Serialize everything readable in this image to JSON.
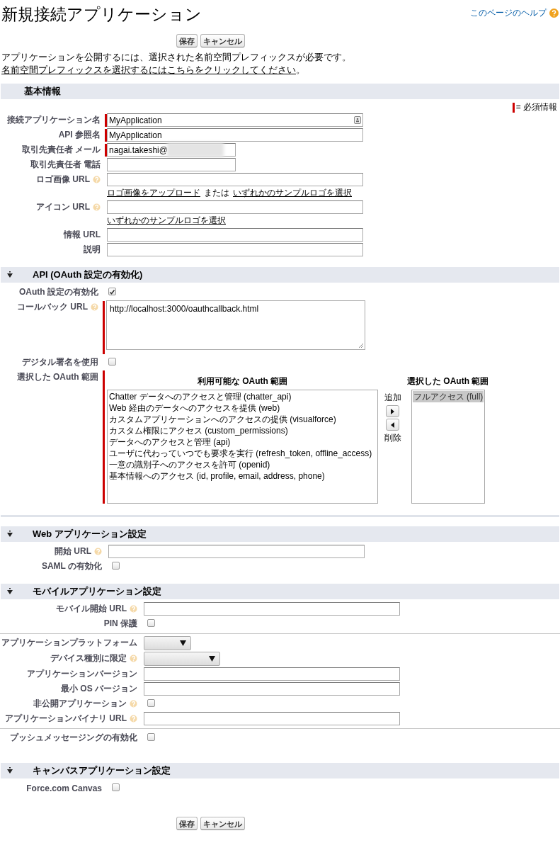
{
  "title": "新規接続アプリケーション",
  "help_link": {
    "text": "このページのヘルプ"
  },
  "top_buttons": [
    {
      "label": "保存"
    },
    {
      "label": "キャンセル"
    }
  ],
  "notice": {
    "text": "アプリケーションを公開するには、選択された名前空間プレフィックスが必要です。",
    "link": "名前空間プレフィックスを選択するにはこちらをクリックしてください",
    "end": "。"
  },
  "sections": [
    {
      "title": "基本情報",
      "collapsible": false,
      "rule_after": false,
      "legend": "= 必須情報",
      "rows": [
        {
          "kind": "input",
          "label": "接続アプリケーション名",
          "value": "MyApplication",
          "required": true,
          "lookup_icon": true
        },
        {
          "kind": "input",
          "label": "API 参照名",
          "value": "MyApplication",
          "required": true
        },
        {
          "kind": "short-input",
          "label": "取引先責任者 メール",
          "value": "nagai.takeshi@",
          "required": true,
          "redacted": true
        },
        {
          "kind": "short-input",
          "label": "取引先責任者 電話"
        },
        {
          "kind": "input",
          "label": "ロゴ画像 URL",
          "help": true,
          "links": [
            {
              "kind": "link",
              "text": "ロゴ画像をアップロード"
            },
            {
              "kind": "text",
              "text": "または"
            },
            {
              "kind": "link",
              "text": "いずれかのサンプルロゴを選択"
            }
          ]
        },
        {
          "kind": "input",
          "label": "アイコン URL",
          "help": true,
          "links": [
            {
              "kind": "link",
              "text": "いずれかのサンプルロゴを選択"
            }
          ]
        },
        {
          "kind": "input",
          "label": "情報 URL"
        },
        {
          "kind": "input",
          "label": "説明"
        }
      ]
    },
    {
      "title": "API (OAuth 設定の有効化)",
      "collapsible": true,
      "rule_after": true,
      "rows": [
        {
          "kind": "checkbox",
          "label": "OAuth 設定の有効化",
          "checked": true
        },
        {
          "kind": "textarea",
          "label": "コールバック URL",
          "help": true,
          "required": true,
          "value": "http://localhost:3000/oauthcallback.html"
        },
        {
          "kind": "checkbox",
          "label": "デジタル署名を使用",
          "checked": false
        },
        {
          "kind": "scopes",
          "label": "選択した OAuth 範囲",
          "required": true,
          "available_title": "利用可能な OAuth 範囲",
          "available": [
            {
              "text": "Chatter データへのアクセスと管理 (chatter_api)",
              "selected": false
            },
            {
              "text": "Web 経由のデータへのアクセスを提供 (web)",
              "selected": false
            },
            {
              "text": "カスタムアプリケーションへのアクセスの提供 (visualforce)",
              "selected": false
            },
            {
              "text": "カスタム権限にアクセス (custom_permissions)",
              "selected": false
            },
            {
              "text": "データへのアクセスと管理 (api)",
              "selected": false
            },
            {
              "text": "ユーザに代わっていつでも要求を実行 (refresh_token, offline_access)",
              "selected": false
            },
            {
              "text": "一意の識別子へのアクセスを許可 (openid)",
              "selected": false
            },
            {
              "text": "基本情報へのアクセス (id, profile, email, address, phone)",
              "selected": false
            }
          ],
          "add_label": "追加",
          "remove_label": "削除",
          "selected_title": "選択した OAuth 範囲",
          "chosen": [
            {
              "text": "フルアクセス (full)",
              "selected": true
            }
          ]
        }
      ]
    },
    {
      "title": "Web アプリケーション設定",
      "collapsible": true,
      "rule_after": false,
      "rows": [
        {
          "kind": "input",
          "label": "開始 URL",
          "help": true
        },
        {
          "kind": "checkbox",
          "label": "SAML の有効化",
          "checked": false
        }
      ]
    },
    {
      "title": "モバイルアプリケーション設定",
      "collapsible": true,
      "rule_after": false,
      "rows": [
        {
          "kind": "input",
          "label": "モバイル開始 URL",
          "help": true
        },
        {
          "kind": "checkbox",
          "label": "PIN 保護",
          "checked": false
        },
        {
          "kind": "short-select",
          "label": "アプリケーションプラットフォーム",
          "divider_before": true
        },
        {
          "kind": "select",
          "label": "デバイス種別に限定",
          "help": true
        },
        {
          "kind": "input",
          "label": "アプリケーションバージョン"
        },
        {
          "kind": "input",
          "label": "最小 OS バージョン"
        },
        {
          "kind": "checkbox",
          "label": "非公開アプリケーション",
          "help": true,
          "checked": false
        },
        {
          "kind": "input",
          "label": "アプリケーションバイナリ URL",
          "help": true
        },
        {
          "kind": "checkbox",
          "label": "プッシュメッセージングの有効化",
          "checked": false,
          "divider_before": true
        }
      ]
    },
    {
      "title": "キャンバスアプリケーション設定",
      "collapsible": true,
      "rule_after": false,
      "rows": [
        {
          "kind": "checkbox",
          "label": "Force.com Canvas",
          "checked": false
        }
      ]
    }
  ],
  "bottom_buttons": [
    {
      "label": "保存"
    },
    {
      "label": "キャンセル"
    }
  ]
}
